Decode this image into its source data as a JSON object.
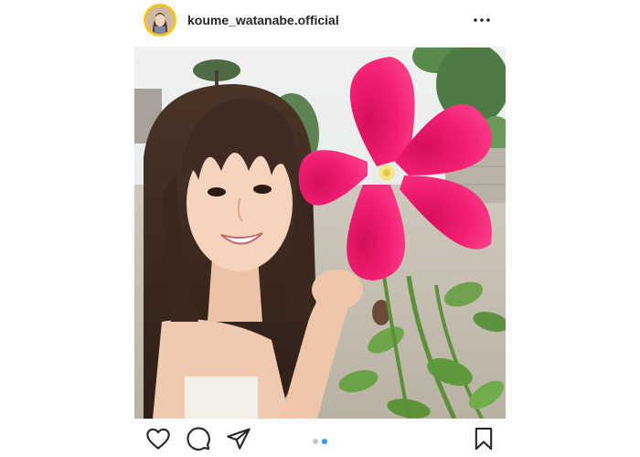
{
  "post": {
    "username": "koume_watanabe.official",
    "image_alt": "Woman smiling next to a large pink hibiscus flower",
    "carousel": {
      "count": 2,
      "active_index": 1
    }
  },
  "colors": {
    "avatar_ring": "#f5c518",
    "dot_active": "#3897f0",
    "dot_inactive": "#c7c7c7",
    "flower": "#f0196e"
  },
  "icons": {
    "more": "more-horizontal-icon",
    "like": "heart-icon",
    "comment": "comment-bubble-icon",
    "share": "paper-plane-icon",
    "save": "bookmark-icon"
  }
}
